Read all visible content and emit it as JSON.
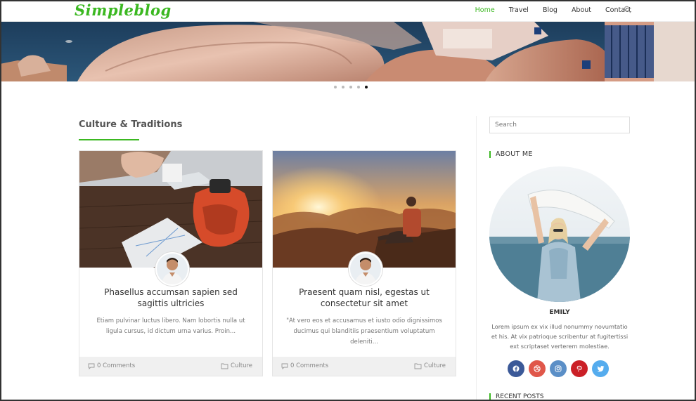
{
  "header": {
    "logo": "Simpleblog",
    "nav": [
      "Home",
      "Travel",
      "Blog",
      "About",
      "Contact"
    ],
    "active_index": 0,
    "search_icon": "search-icon"
  },
  "slider": {
    "dots": 5,
    "active_dot": 4
  },
  "main": {
    "section_title": "Culture & Traditions",
    "posts": [
      {
        "title": "Phasellus accumsan sapien sed sagittis ultricies",
        "excerpt": "Etiam pulvinar luctus libero. Nam lobortis nulla ut ligula cursus, id dictum urna varius. Proin...",
        "comments": "0 Comments",
        "category": "Culture"
      },
      {
        "title": "Praesent quam nisl, egestas ut consectetur sit amet",
        "excerpt": "\"At vero eos et accusamus et iusto odio dignissimos ducimus qui blanditiis praesentium voluptatum deleniti...",
        "comments": "0 Comments",
        "category": "Culture"
      }
    ]
  },
  "sidebar": {
    "search_placeholder": "Search",
    "about_title": "ABOUT ME",
    "about_name": "EMILY",
    "about_text": "Lorem ipsum ex vix illud nonummy novumtatio et his. At vix patrioque scribentur at fugitertissi ext scriptaset verterem molestiae.",
    "socials": [
      {
        "icon": "facebook-icon",
        "color": "#3b5998"
      },
      {
        "icon": "dribbble-icon",
        "color": "#e0574a"
      },
      {
        "icon": "instagram-icon",
        "color": "#5b8fc7"
      },
      {
        "icon": "pinterest-icon",
        "color": "#cb2027"
      },
      {
        "icon": "twitter-icon",
        "color": "#55acee"
      }
    ],
    "recent_title": "RECENT POSTS"
  },
  "colors": {
    "accent": "#3bb821"
  }
}
